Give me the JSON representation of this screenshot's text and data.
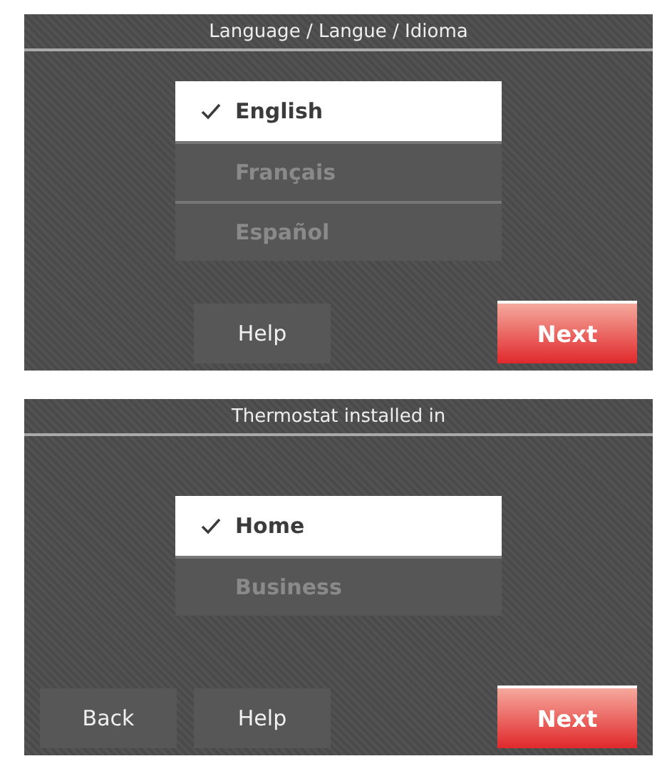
{
  "screens": [
    {
      "title": "Language / Langue / Idioma",
      "options": [
        {
          "label": "English",
          "selected": true
        },
        {
          "label": "Français",
          "selected": false
        },
        {
          "label": "Español",
          "selected": false
        }
      ],
      "buttons": [
        {
          "kind": "help",
          "label": "Help"
        },
        {
          "kind": "next",
          "label": "Next"
        }
      ]
    },
    {
      "title": "Thermostat installed in",
      "options": [
        {
          "label": "Home",
          "selected": true
        },
        {
          "label": "Business",
          "selected": false
        }
      ],
      "buttons": [
        {
          "kind": "back",
          "label": "Back"
        },
        {
          "kind": "help",
          "label": "Help"
        },
        {
          "kind": "next",
          "label": "Next"
        }
      ]
    }
  ]
}
